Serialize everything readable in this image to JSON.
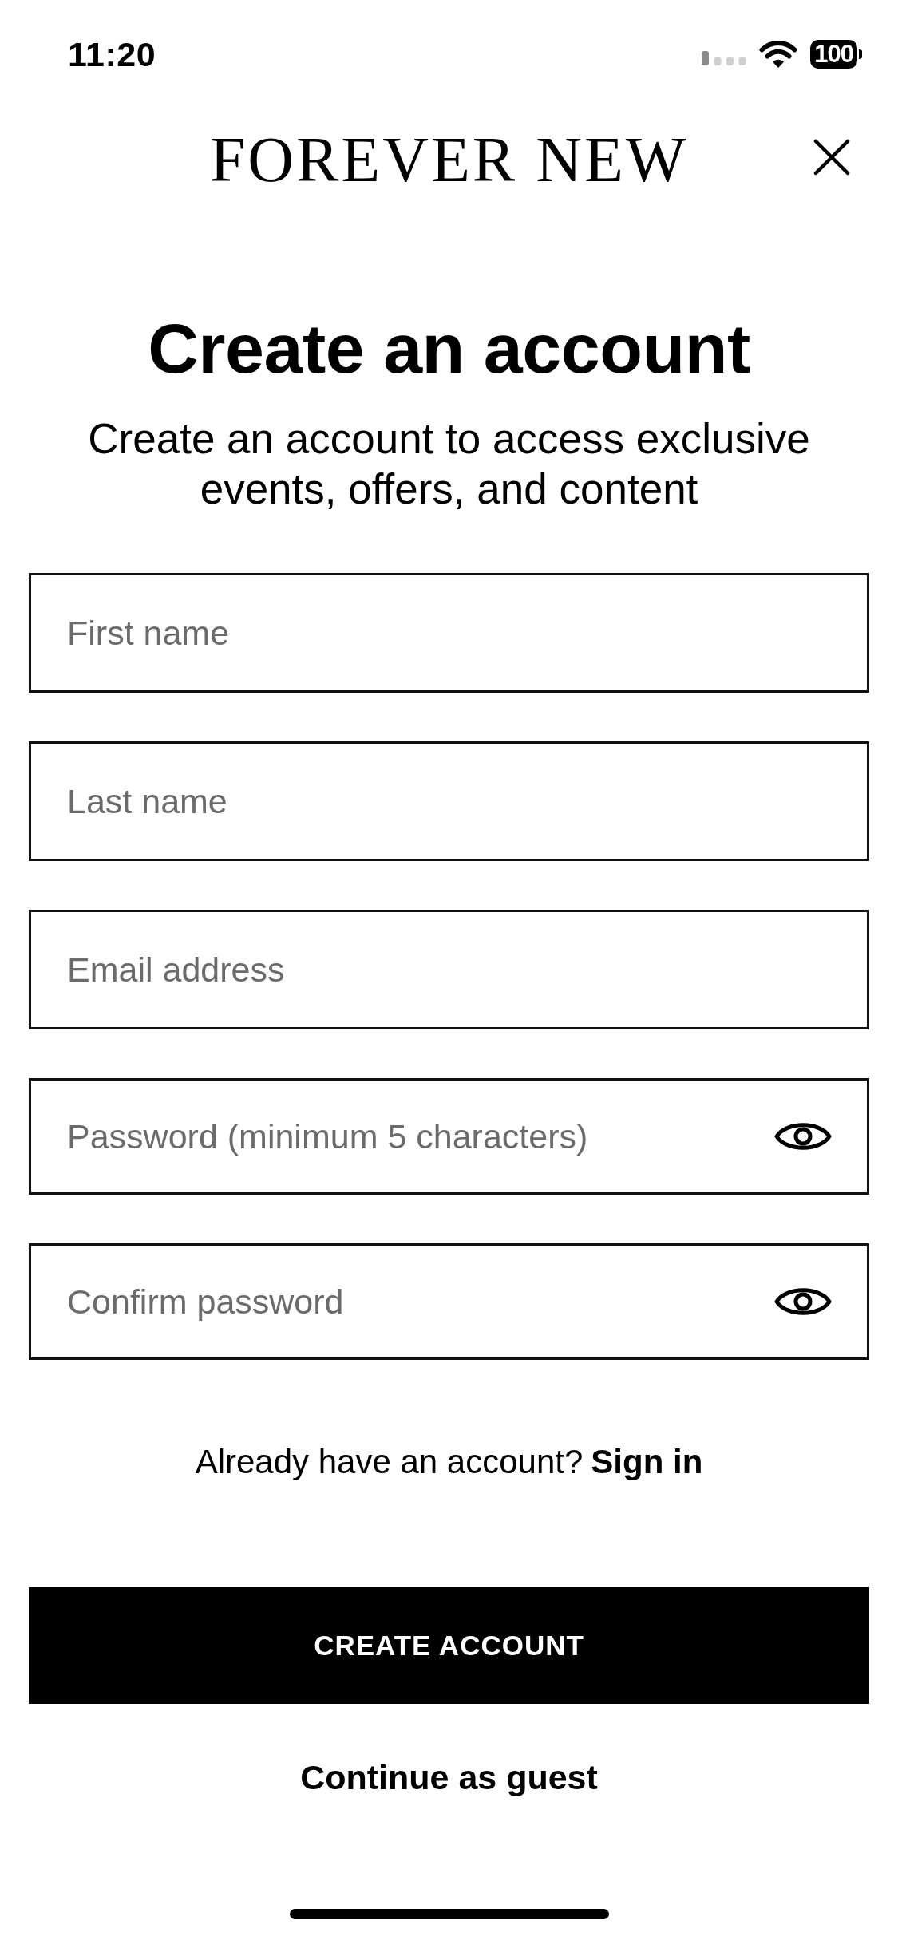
{
  "status_bar": {
    "time": "11:20",
    "battery": "100"
  },
  "header": {
    "logo": "FOREVER NEW"
  },
  "title": "Create an account",
  "subtitle": "Create an account to access exclusive events, offers, and content",
  "fields": [
    {
      "kind": "text",
      "placeholder": "First name"
    },
    {
      "kind": "text",
      "placeholder": "Last name"
    },
    {
      "kind": "text",
      "placeholder": "Email address"
    },
    {
      "kind": "password",
      "placeholder": "Password (minimum 5 characters)"
    },
    {
      "kind": "password",
      "placeholder": "Confirm password"
    }
  ],
  "sign_in": {
    "prompt": "Already have an account?",
    "link": "Sign in"
  },
  "primary_button": "CREATE ACCOUNT",
  "secondary_link": "Continue as guest"
}
